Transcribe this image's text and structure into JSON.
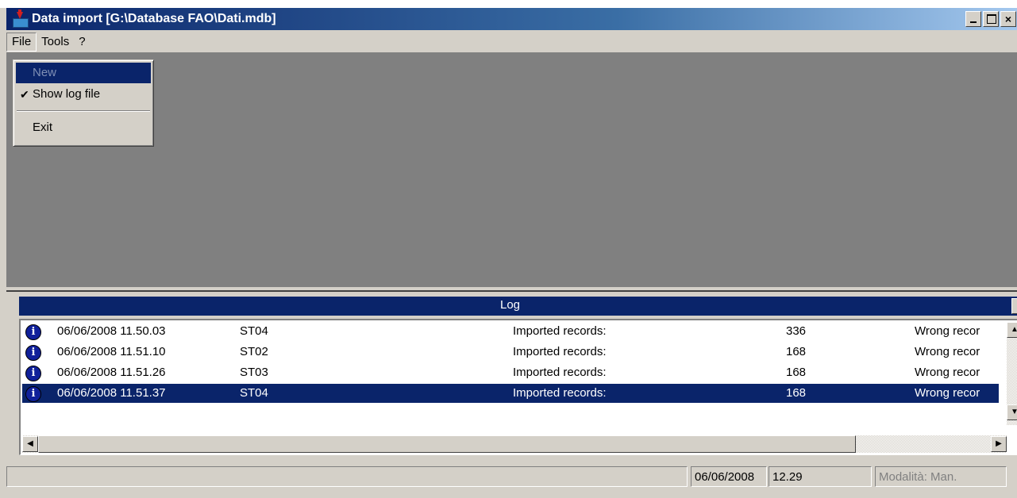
{
  "window": {
    "title": "Data import [G:\\Database FAO\\Dati.mdb]",
    "minimize": "minimize-icon",
    "maximize": "maximize-icon",
    "close_glyph": "×"
  },
  "menubar": {
    "file": "File",
    "tools": "Tools",
    "help": "?"
  },
  "file_menu": {
    "items": [
      {
        "label": "New",
        "enabled": false,
        "highlighted": true
      },
      {
        "label": "Show log file",
        "checked": true
      },
      {
        "label": "Exit"
      }
    ]
  },
  "log": {
    "title": "Log",
    "close_glyph": "×",
    "rows": [
      {
        "time": "06/06/2008 11.50.03",
        "station": "ST04",
        "label": "Imported records:",
        "count": "336",
        "wrong": "Wrong recor"
      },
      {
        "time": "06/06/2008 11.51.10",
        "station": "ST02",
        "label": "Imported records:",
        "count": "168",
        "wrong": "Wrong recor"
      },
      {
        "time": "06/06/2008 11.51.26",
        "station": "ST03",
        "label": "Imported records:",
        "count": "168",
        "wrong": "Wrong recor"
      },
      {
        "time": "06/06/2008 11.51.37",
        "station": "ST04",
        "label": "Imported records:",
        "count": "168",
        "wrong": "Wrong recor",
        "selected": true
      }
    ],
    "row_icon": "info-icon",
    "info_glyph": "i",
    "scroll_up": "▲",
    "scroll_down": "▼",
    "scroll_left": "◀",
    "scroll_right": "▶"
  },
  "statusbar": {
    "message": "",
    "date": "06/06/2008",
    "time": "12.29",
    "mode": "Modalità: Man."
  },
  "colors": {
    "title_gradient_start": "#0a246a",
    "title_gradient_end": "#a6caf0",
    "selection": "#0a246a",
    "face": "#d4d0c8",
    "mdi_background": "#808080"
  }
}
